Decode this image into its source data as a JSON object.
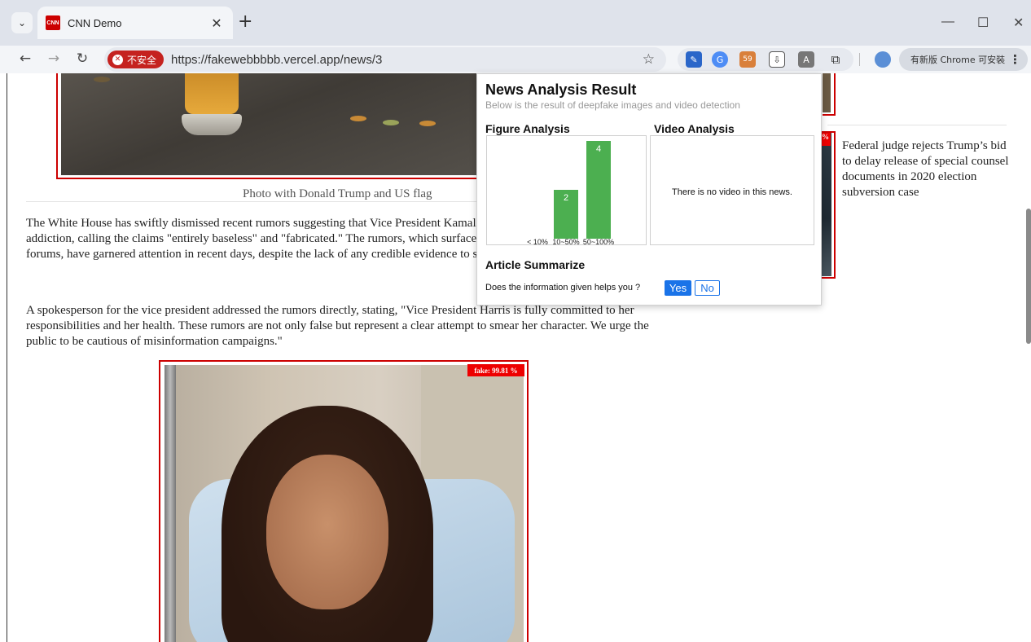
{
  "browser": {
    "tab_title": "CNN Demo",
    "tab_favicon_text": "CNN",
    "tab_close": "✕",
    "new_tab": "+",
    "window_controls": {
      "minimize": "—",
      "maximize": "☐",
      "close": "✕"
    },
    "security_label": "不安全",
    "url": "https://fakewebbbbb.vercel.app/news/3",
    "extension_badge_count": "59",
    "update_chip_label": "有新版 Chrome 可安裝"
  },
  "article": {
    "top_image_caption": "Photo with Donald Trump and US flag",
    "paragraph_1": "The White House has swiftly dismissed recent rumors suggesting that Vice President Kamala Harris is struggling with alcohol addiction, calling the claims \"entirely baseless\" and \"fabricated.\" The rumors, which surfaced on social media and various online forums, have garnered attention in recent days, despite the lack of any credible evidence to support the allegations.",
    "paragraph_2": "A spokesperson for the vice president addressed the rumors directly, stating, \"Vice President Harris is fully committed to her responsibilities and her health. These rumors are not only false but represent a clear attempt to smear her character. We urge the public to be cautious of misinformation campaigns.\"",
    "portrait_badge": "fake: 99.81 %",
    "side_fake_badge": "%",
    "side_article": "Federal judge rejects Trump’s bid to delay release of special counsel documents in 2020 election subversion case"
  },
  "popup": {
    "title": "News Analysis Result",
    "subtitle": "Below is the result of deepfake images and video detection",
    "figure_section": "Figure Analysis",
    "video_section": "Video Analysis",
    "video_message": "There is no video in this news.",
    "summary_section": "Article Summarize",
    "feedback_question": "Does the information given helps you ?",
    "yes_label": "Yes",
    "no_label": "No"
  },
  "chart_data": {
    "type": "bar",
    "categories": [
      "< 10%",
      "10~50%",
      "50~100%"
    ],
    "values": [
      0,
      2,
      4
    ],
    "color": "#4caf50",
    "ylim": [
      0,
      4
    ],
    "grid": false
  }
}
